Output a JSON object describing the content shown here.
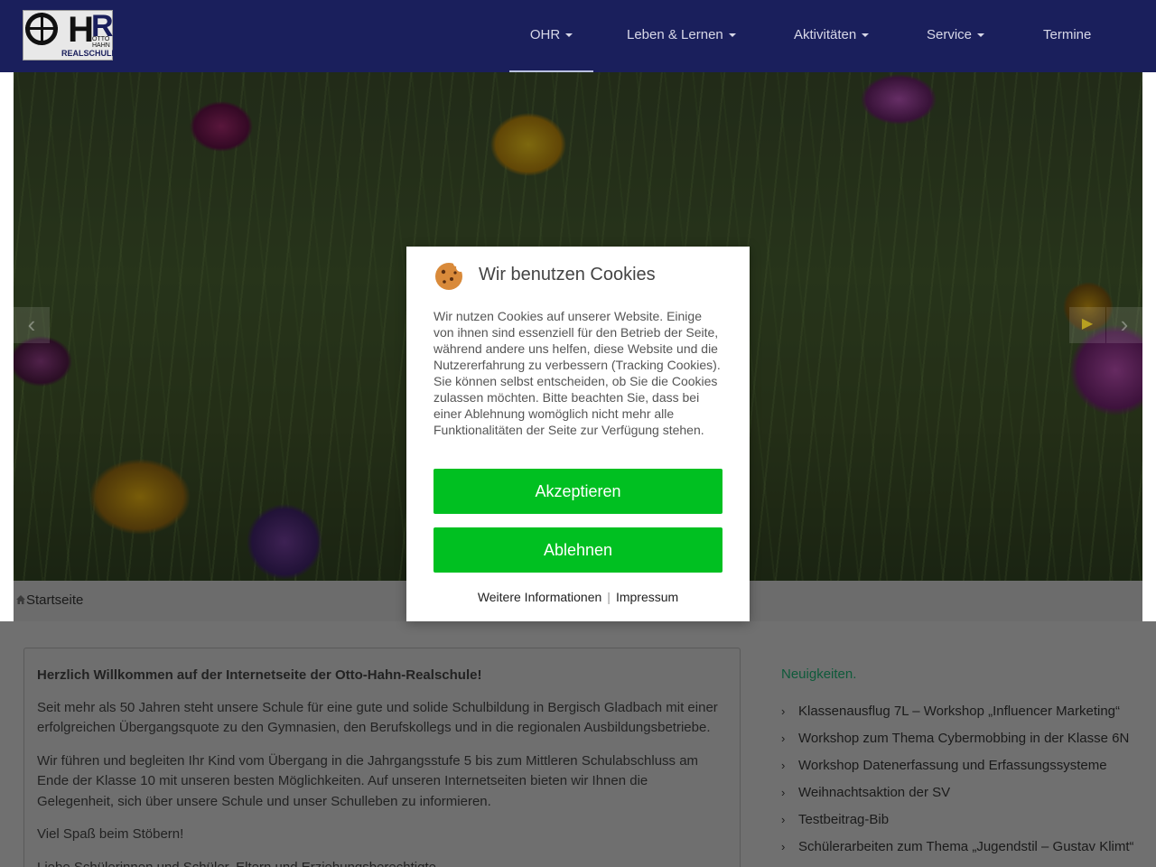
{
  "logo": {
    "letters": "OHR",
    "sub_top": "OTTO HAHN",
    "sub_bottom": "REALSCHULE"
  },
  "nav": {
    "items": [
      {
        "label": "OHR",
        "has_caret": true
      },
      {
        "label": "Leben & Lernen",
        "has_caret": true
      },
      {
        "label": "Aktivitäten",
        "has_caret": true
      },
      {
        "label": "Service",
        "has_caret": true
      },
      {
        "label": "Termine",
        "has_caret": false
      }
    ]
  },
  "carousel": {
    "prev": "‹",
    "play": "▶",
    "next": "›"
  },
  "breadcrumb": {
    "home_label": "Startseite"
  },
  "main": {
    "heading": "Herzlich Willkommen auf der Internetseite der Otto-Hahn-Realschule!",
    "p1": "Seit mehr als 50 Jahren steht unsere Schule für eine gute und solide Schulbildung in Bergisch Gladbach mit einer erfolgreichen Übergangsquote zu den Gymnasien, den Berufskollegs und in die regionalen Ausbildungsbetriebe.",
    "p2": "Wir führen und begleiten Ihr Kind vom Übergang in die Jahrgangsstufe 5 bis zum Mittleren Schulabschluss am Ende der Klasse 10 mit unseren besten Möglichkeiten. Auf unseren Internetseiten bieten wir Ihnen die Gelegenheit, sich über unsere Schule und unser Schulleben zu informieren.",
    "p3": "Viel Spaß beim Stöbern!",
    "p4": "Liebe Schülerinnen und Schüler, Eltern und Erziehungsberechtigte,"
  },
  "sidebar": {
    "title": "Neuigkeiten.",
    "items": [
      "Klassenausflug 7L – Workshop „Influencer Marketing“",
      "Workshop zum Thema Cybermobbing in der Klasse 6N",
      "Workshop Datenerfassung und Erfassungssysteme",
      "Weihnachtsaktion der SV",
      "Testbeitrag-Bib",
      "Schülerarbeiten zum Thema „Jugendstil – Gustav Klimt“"
    ]
  },
  "cookie_modal": {
    "title": "Wir benutzen Cookies",
    "text": "Wir nutzen Cookies auf unserer Website. Einige von ihnen sind essenziell für den Betrieb der Seite, während andere uns helfen, diese Website und die Nutzererfahrung zu verbessern (Tracking Cookies). Sie können selbst entscheiden, ob Sie die Cookies zulassen möchten. Bitte beachten Sie, dass bei einer Ablehnung womöglich nicht mehr alle Funktionalitäten der Seite zur Verfügung stehen.",
    "accept_label": "Akzeptieren",
    "decline_label": "Ablehnen",
    "more_info_label": "Weitere Informationen",
    "separator": "|",
    "impressum_label": "Impressum"
  },
  "colors": {
    "navbar": "#1a1f5c",
    "button_green": "#00c021",
    "sidebar_title": "#0e5a3a"
  }
}
